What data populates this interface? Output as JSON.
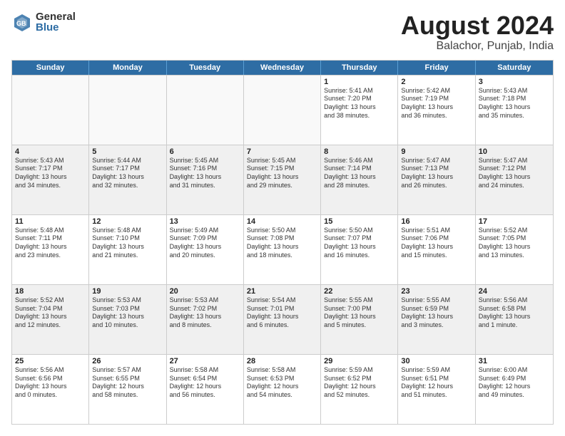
{
  "logo": {
    "general": "General",
    "blue": "Blue"
  },
  "title": "August 2024",
  "location": "Balachor, Punjab, India",
  "days": [
    "Sunday",
    "Monday",
    "Tuesday",
    "Wednesday",
    "Thursday",
    "Friday",
    "Saturday"
  ],
  "weeks": [
    [
      {
        "day": "",
        "content": "",
        "empty": true
      },
      {
        "day": "",
        "content": "",
        "empty": true
      },
      {
        "day": "",
        "content": "",
        "empty": true
      },
      {
        "day": "",
        "content": "",
        "empty": true
      },
      {
        "day": "1",
        "content": "Sunrise: 5:41 AM\nSunset: 7:20 PM\nDaylight: 13 hours\nand 38 minutes.",
        "empty": false
      },
      {
        "day": "2",
        "content": "Sunrise: 5:42 AM\nSunset: 7:19 PM\nDaylight: 13 hours\nand 36 minutes.",
        "empty": false
      },
      {
        "day": "3",
        "content": "Sunrise: 5:43 AM\nSunset: 7:18 PM\nDaylight: 13 hours\nand 35 minutes.",
        "empty": false
      }
    ],
    [
      {
        "day": "4",
        "content": "Sunrise: 5:43 AM\nSunset: 7:17 PM\nDaylight: 13 hours\nand 34 minutes.",
        "empty": false
      },
      {
        "day": "5",
        "content": "Sunrise: 5:44 AM\nSunset: 7:17 PM\nDaylight: 13 hours\nand 32 minutes.",
        "empty": false
      },
      {
        "day": "6",
        "content": "Sunrise: 5:45 AM\nSunset: 7:16 PM\nDaylight: 13 hours\nand 31 minutes.",
        "empty": false
      },
      {
        "day": "7",
        "content": "Sunrise: 5:45 AM\nSunset: 7:15 PM\nDaylight: 13 hours\nand 29 minutes.",
        "empty": false
      },
      {
        "day": "8",
        "content": "Sunrise: 5:46 AM\nSunset: 7:14 PM\nDaylight: 13 hours\nand 28 minutes.",
        "empty": false
      },
      {
        "day": "9",
        "content": "Sunrise: 5:47 AM\nSunset: 7:13 PM\nDaylight: 13 hours\nand 26 minutes.",
        "empty": false
      },
      {
        "day": "10",
        "content": "Sunrise: 5:47 AM\nSunset: 7:12 PM\nDaylight: 13 hours\nand 24 minutes.",
        "empty": false
      }
    ],
    [
      {
        "day": "11",
        "content": "Sunrise: 5:48 AM\nSunset: 7:11 PM\nDaylight: 13 hours\nand 23 minutes.",
        "empty": false
      },
      {
        "day": "12",
        "content": "Sunrise: 5:48 AM\nSunset: 7:10 PM\nDaylight: 13 hours\nand 21 minutes.",
        "empty": false
      },
      {
        "day": "13",
        "content": "Sunrise: 5:49 AM\nSunset: 7:09 PM\nDaylight: 13 hours\nand 20 minutes.",
        "empty": false
      },
      {
        "day": "14",
        "content": "Sunrise: 5:50 AM\nSunset: 7:08 PM\nDaylight: 13 hours\nand 18 minutes.",
        "empty": false
      },
      {
        "day": "15",
        "content": "Sunrise: 5:50 AM\nSunset: 7:07 PM\nDaylight: 13 hours\nand 16 minutes.",
        "empty": false
      },
      {
        "day": "16",
        "content": "Sunrise: 5:51 AM\nSunset: 7:06 PM\nDaylight: 13 hours\nand 15 minutes.",
        "empty": false
      },
      {
        "day": "17",
        "content": "Sunrise: 5:52 AM\nSunset: 7:05 PM\nDaylight: 13 hours\nand 13 minutes.",
        "empty": false
      }
    ],
    [
      {
        "day": "18",
        "content": "Sunrise: 5:52 AM\nSunset: 7:04 PM\nDaylight: 13 hours\nand 12 minutes.",
        "empty": false
      },
      {
        "day": "19",
        "content": "Sunrise: 5:53 AM\nSunset: 7:03 PM\nDaylight: 13 hours\nand 10 minutes.",
        "empty": false
      },
      {
        "day": "20",
        "content": "Sunrise: 5:53 AM\nSunset: 7:02 PM\nDaylight: 13 hours\nand 8 minutes.",
        "empty": false
      },
      {
        "day": "21",
        "content": "Sunrise: 5:54 AM\nSunset: 7:01 PM\nDaylight: 13 hours\nand 6 minutes.",
        "empty": false
      },
      {
        "day": "22",
        "content": "Sunrise: 5:55 AM\nSunset: 7:00 PM\nDaylight: 13 hours\nand 5 minutes.",
        "empty": false
      },
      {
        "day": "23",
        "content": "Sunrise: 5:55 AM\nSunset: 6:59 PM\nDaylight: 13 hours\nand 3 minutes.",
        "empty": false
      },
      {
        "day": "24",
        "content": "Sunrise: 5:56 AM\nSunset: 6:58 PM\nDaylight: 13 hours\nand 1 minute.",
        "empty": false
      }
    ],
    [
      {
        "day": "25",
        "content": "Sunrise: 5:56 AM\nSunset: 6:56 PM\nDaylight: 13 hours\nand 0 minutes.",
        "empty": false
      },
      {
        "day": "26",
        "content": "Sunrise: 5:57 AM\nSunset: 6:55 PM\nDaylight: 12 hours\nand 58 minutes.",
        "empty": false
      },
      {
        "day": "27",
        "content": "Sunrise: 5:58 AM\nSunset: 6:54 PM\nDaylight: 12 hours\nand 56 minutes.",
        "empty": false
      },
      {
        "day": "28",
        "content": "Sunrise: 5:58 AM\nSunset: 6:53 PM\nDaylight: 12 hours\nand 54 minutes.",
        "empty": false
      },
      {
        "day": "29",
        "content": "Sunrise: 5:59 AM\nSunset: 6:52 PM\nDaylight: 12 hours\nand 52 minutes.",
        "empty": false
      },
      {
        "day": "30",
        "content": "Sunrise: 5:59 AM\nSunset: 6:51 PM\nDaylight: 12 hours\nand 51 minutes.",
        "empty": false
      },
      {
        "day": "31",
        "content": "Sunrise: 6:00 AM\nSunset: 6:49 PM\nDaylight: 12 hours\nand 49 minutes.",
        "empty": false
      }
    ]
  ]
}
